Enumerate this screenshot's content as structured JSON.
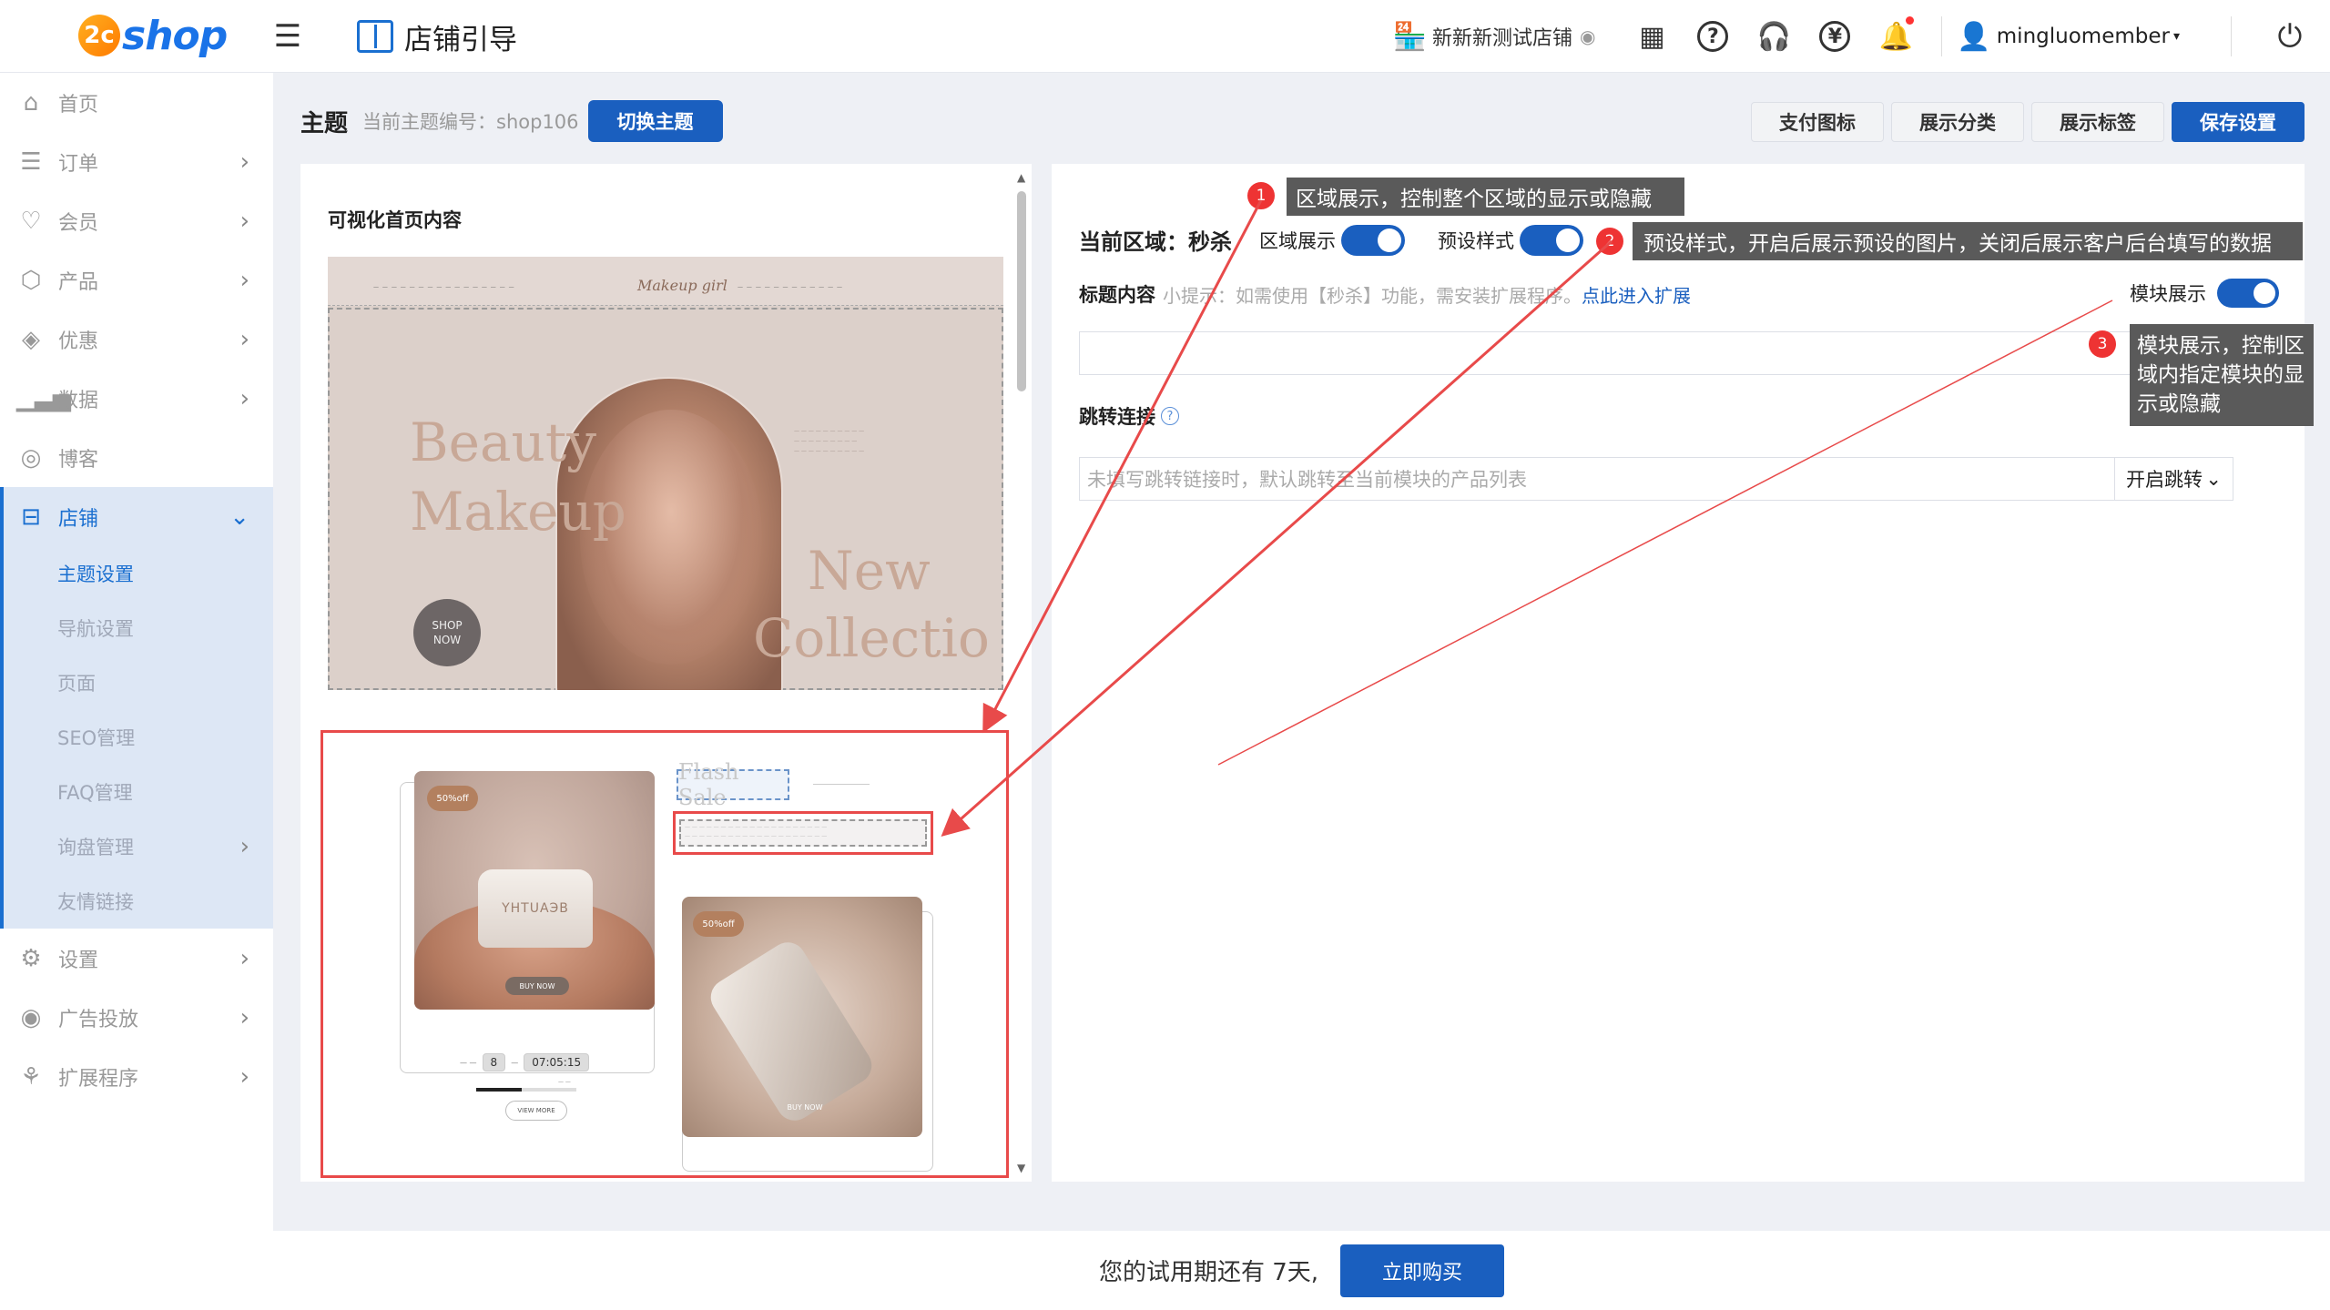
{
  "app": {
    "logo_mark": "2c",
    "logo_text": "shop",
    "page_heading": "店铺引导",
    "store_name": "新新新测试店铺",
    "username": "mingluomember"
  },
  "sidebar": {
    "items": [
      {
        "label": "首页",
        "icon": "home-icon"
      },
      {
        "label": "订单",
        "icon": "order-icon"
      },
      {
        "label": "会员",
        "icon": "member-icon"
      },
      {
        "label": "产品",
        "icon": "product-icon"
      },
      {
        "label": "优惠",
        "icon": "coupon-icon"
      },
      {
        "label": "数据",
        "icon": "chart-icon"
      },
      {
        "label": "博客",
        "icon": "blog-icon"
      },
      {
        "label": "店铺",
        "icon": "store-icon"
      }
    ],
    "sub_items": [
      "主题设置",
      "导航设置",
      "页面",
      "SEO管理",
      "FAQ管理",
      "询盘管理",
      "友情链接"
    ],
    "bottom_items": [
      {
        "label": "设置",
        "icon": "settings-icon"
      },
      {
        "label": "广告投放",
        "icon": "ads-icon"
      },
      {
        "label": "扩展程序",
        "icon": "extensions-icon"
      }
    ]
  },
  "header": {
    "title": "主题",
    "theme_label": "当前主题编号：shop106",
    "switch_theme": "切换主题",
    "buttons": [
      "支付图标",
      "展示分类",
      "展示标签"
    ],
    "save": "保存设置"
  },
  "preview": {
    "title": "可视化首页内容",
    "hero": {
      "brand": "Makeup girl",
      "text_left": [
        "Beauty",
        "Makeup"
      ],
      "text_right": [
        "New",
        "Collectio"
      ],
      "shop_now": [
        "SHOP",
        "NOW"
      ]
    },
    "flash": {
      "title": "Flash Sale",
      "tag": "50%off",
      "jar_label": "YHTUAЭB",
      "buy_now": "BUY NOW",
      "countdown_day": "8",
      "countdown_time": "07:05:15",
      "view_more": "VIEW MORE"
    }
  },
  "settings": {
    "current_region": "当前区域：秒杀",
    "region_toggle": "区域展示",
    "preset_toggle": "预设样式",
    "title_label": "标题内容",
    "title_hint": "小提示：如需使用【秒杀】功能，需安装扩展程序。",
    "title_hint_link": "点此进入扩展",
    "module_toggle": "模块展示",
    "jump_label": "跳转连接",
    "jump_placeholder": "未填写跳转链接时，默认跳转至当前模块的产品列表",
    "jump_select": "开启跳转"
  },
  "callouts": [
    {
      "num": "1",
      "text": "区域展示，控制整个区域的显示或隐藏"
    },
    {
      "num": "2",
      "text": "预设样式，开启后展示预设的图片，关闭后展示客户后台填写的数据"
    },
    {
      "num": "3",
      "lines": [
        "模块展示，控制区",
        "域内指定模块的显",
        "示或隐藏"
      ]
    }
  ],
  "footer": {
    "trial": "您的试用期还有 7天,",
    "buy": "立即购买"
  },
  "colors": {
    "primary": "#1a5fbf",
    "annotation_red": "#e84a4a",
    "callout_bg": "#5a5a5a"
  }
}
